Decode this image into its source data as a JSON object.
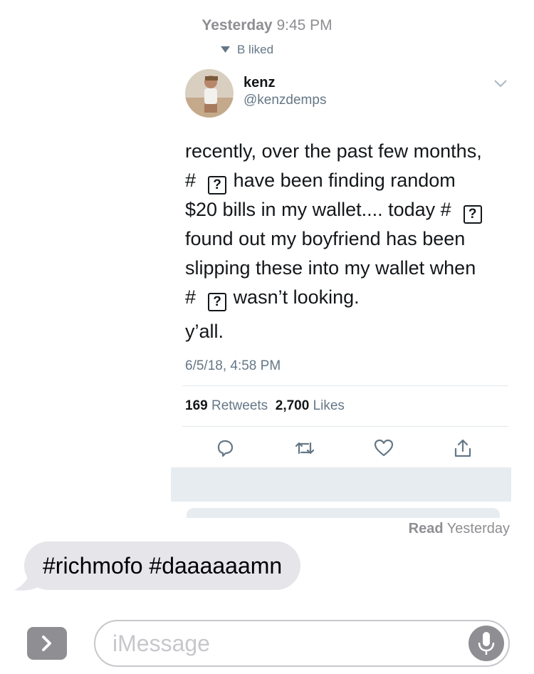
{
  "header": {
    "ts_bold": "Yesterday",
    "ts_time": "9:45 PM"
  },
  "cutoff_text": "B liked",
  "tweet": {
    "name": "kenz",
    "handle": "@kenzdemps",
    "line1": "recently, over the past few months,",
    "line2a": "#",
    "line2b": "have been finding random",
    "line3a": "$20 bills in my wallet.... today #",
    "line4": "found out my boyfriend has been",
    "line5": "slipping these into my wallet when",
    "line6a": "#",
    "line6b": "wasn’t looking.",
    "missing_glyph": "?",
    "yall": "y’all.",
    "date": "6/5/18, 4:58 PM",
    "retweets_count": "169",
    "retweets_label": "Retweets",
    "likes_count": "2,700",
    "likes_label": "Likes"
  },
  "read_receipt": {
    "bold": "Read",
    "rest": "Yesterday"
  },
  "message": {
    "text": "#richmofo #daaaaaamn"
  },
  "composer": {
    "placeholder": "iMessage"
  },
  "colors": {
    "twitter_gray": "#657786",
    "bubble": "#e5e5ea",
    "divider": "#e1e8ed"
  },
  "icons": [
    "reply-icon",
    "retweet-icon",
    "like-icon",
    "share-icon",
    "chevron-down-icon",
    "apps-icon",
    "microphone-icon"
  ]
}
